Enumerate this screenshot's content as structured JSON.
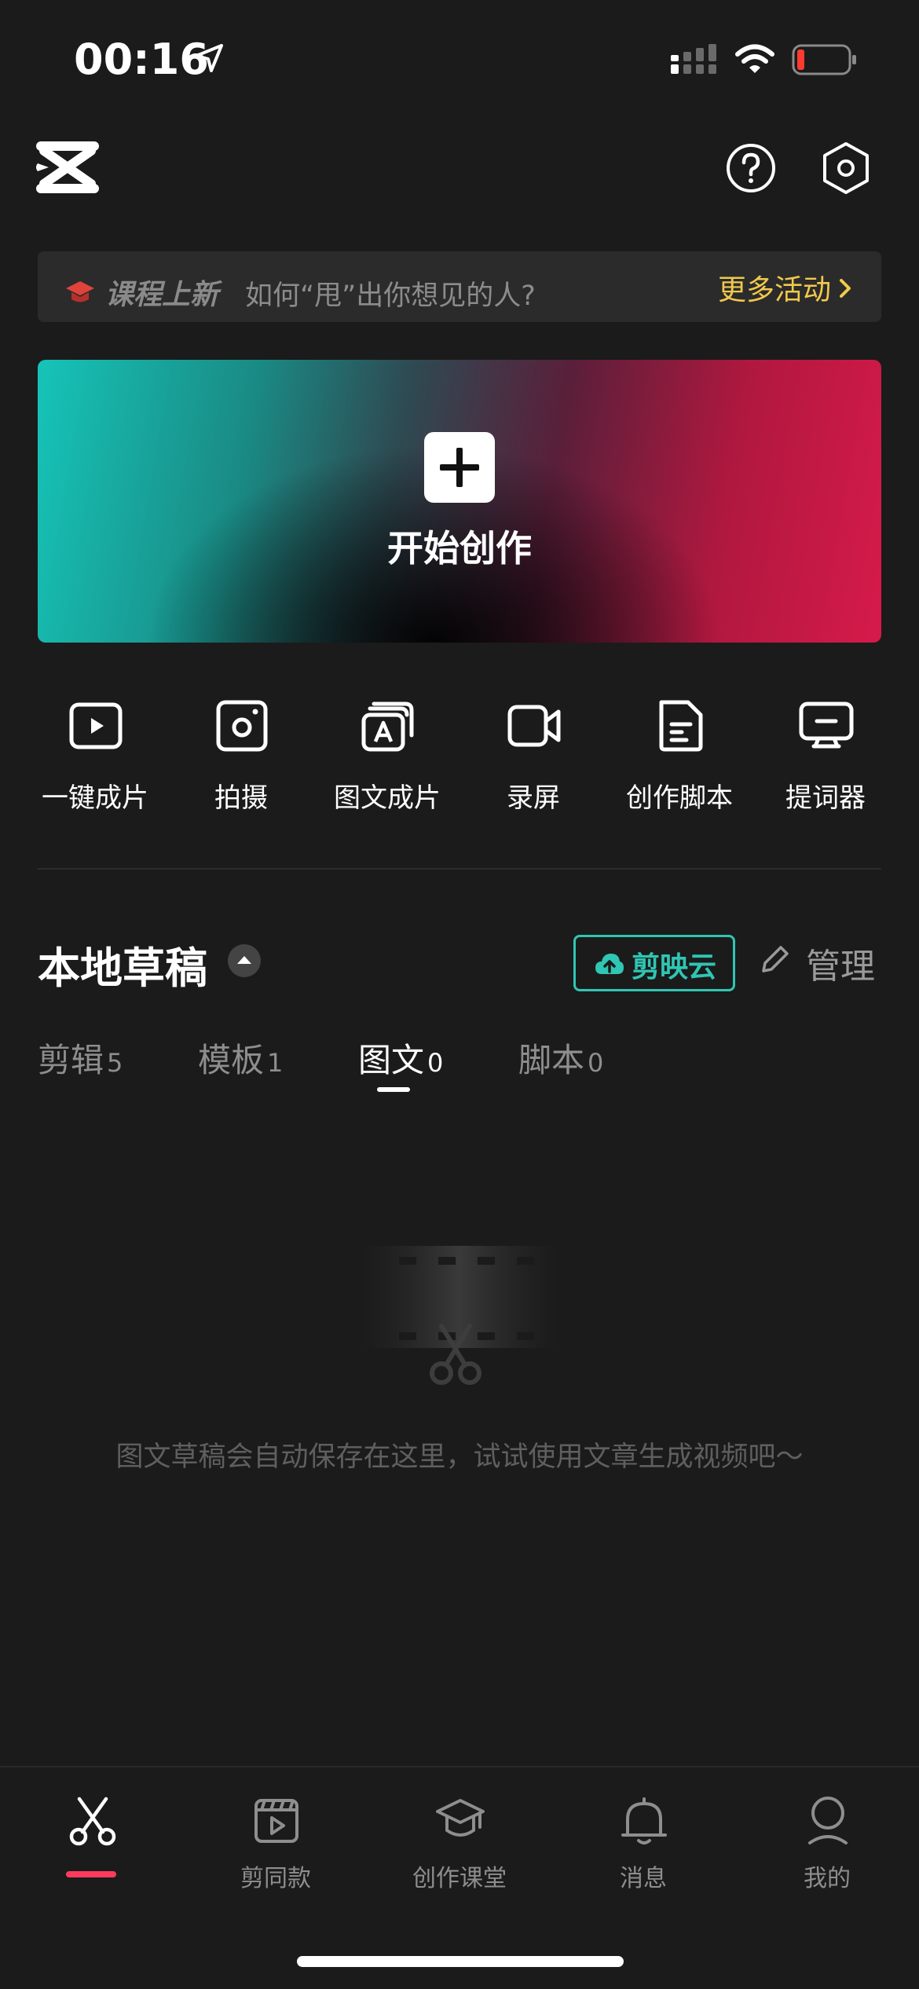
{
  "status_bar": {
    "time": "00:16"
  },
  "banner": {
    "tag": "课程上新",
    "text": "如何“甩”出你想见的人?",
    "more": "更多活动"
  },
  "hero": {
    "label": "开始创作"
  },
  "tools": [
    {
      "label": "一键成片",
      "icon": "play-square-icon"
    },
    {
      "label": "拍摄",
      "icon": "camera-icon"
    },
    {
      "label": "图文成片",
      "icon": "text-to-video-icon"
    },
    {
      "label": "录屏",
      "icon": "screen-record-icon"
    },
    {
      "label": "创作脚本",
      "icon": "script-doc-icon"
    },
    {
      "label": "提词器",
      "icon": "teleprompter-icon"
    }
  ],
  "drafts": {
    "title": "本地草稿",
    "cloud_label": "剪映云",
    "manage_label": "管理",
    "tabs": [
      {
        "label": "剪辑",
        "count": "5"
      },
      {
        "label": "模板",
        "count": "1"
      },
      {
        "label": "图文",
        "count": "0"
      },
      {
        "label": "脚本",
        "count": "0"
      }
    ],
    "active_tab": "图文",
    "empty_text": "图文草稿会自动保存在这里，试试使用文章生成视频吧～"
  },
  "bottom_nav": [
    {
      "label": "",
      "icon": "scissors-icon"
    },
    {
      "label": "剪同款",
      "icon": "clapper-icon"
    },
    {
      "label": "创作课堂",
      "icon": "graduation-cap-icon"
    },
    {
      "label": "消息",
      "icon": "bell-icon"
    },
    {
      "label": "我的",
      "icon": "person-icon"
    }
  ],
  "colors": {
    "background": "#1b1b1b",
    "accent_cyan": "#2fc6b3",
    "banner_more": "#f2c94c",
    "nav_active": "#ff3b5c"
  }
}
